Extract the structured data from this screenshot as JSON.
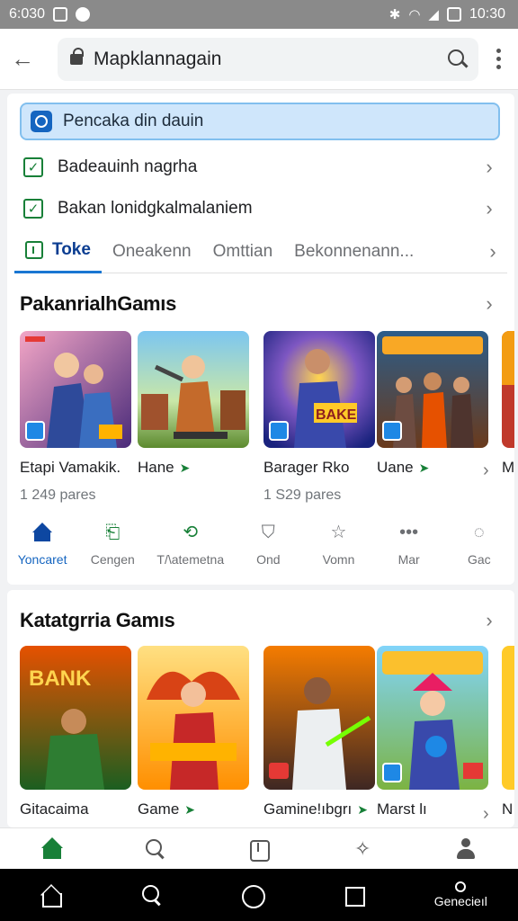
{
  "status_bar": {
    "time_left": "6:030",
    "time_right": "10:30"
  },
  "browser": {
    "url": "Mapklannagain"
  },
  "promo": {
    "text": "Pencaka din dauin"
  },
  "checklist": [
    {
      "label": "Badeauinh nagrha"
    },
    {
      "label": "Bakan lonidgkalmalaniem"
    }
  ],
  "tabs": [
    {
      "label": "Toke",
      "active": true
    },
    {
      "label": "Oneakenn",
      "active": false
    },
    {
      "label": "Omttian",
      "active": false
    },
    {
      "label": "Bekonnenann...",
      "active": false
    }
  ],
  "section1": {
    "title": "PakanrialhGamıs",
    "games": [
      {
        "name": "Etapi Vamakik.",
        "meta": "1 249 pares"
      },
      {
        "name": "Hane",
        "meta": ""
      },
      {
        "name": "Barager Rko",
        "meta": "1 S29 pares"
      },
      {
        "name": "Uane",
        "meta": ""
      },
      {
        "name": "M",
        "meta": ""
      }
    ]
  },
  "categories": [
    {
      "label": "Yoncaret",
      "icon": "home-icon",
      "active": true
    },
    {
      "label": "Cengen",
      "icon": "bookmark-icon",
      "active": false
    },
    {
      "label": "T/\\atemetna",
      "icon": "refresh-icon",
      "active": false
    },
    {
      "label": "Ond",
      "icon": "shield-icon",
      "active": false
    },
    {
      "label": "Vomn",
      "icon": "star-icon",
      "active": false
    },
    {
      "label": "Mar",
      "icon": "more-icon",
      "active": false
    },
    {
      "label": "Gac",
      "icon": "chat-icon",
      "active": false
    }
  ],
  "section2": {
    "title": "Katatgrria Gamıs",
    "games": [
      {
        "name": "Gitacaima"
      },
      {
        "name": "Game"
      },
      {
        "name": "Gamine!ıbgrı"
      },
      {
        "name": "Marst l⁠ı"
      },
      {
        "name": "N"
      }
    ]
  },
  "bottom_nav": [
    "home-icon",
    "search-icon",
    "library-icon",
    "games-icon",
    "account-icon"
  ],
  "system_nav": {
    "label": "Genecieıl"
  },
  "colors": {
    "accent_blue": "#1976d2",
    "accent_green": "#188038",
    "status_bar": "#8a8a8a"
  }
}
